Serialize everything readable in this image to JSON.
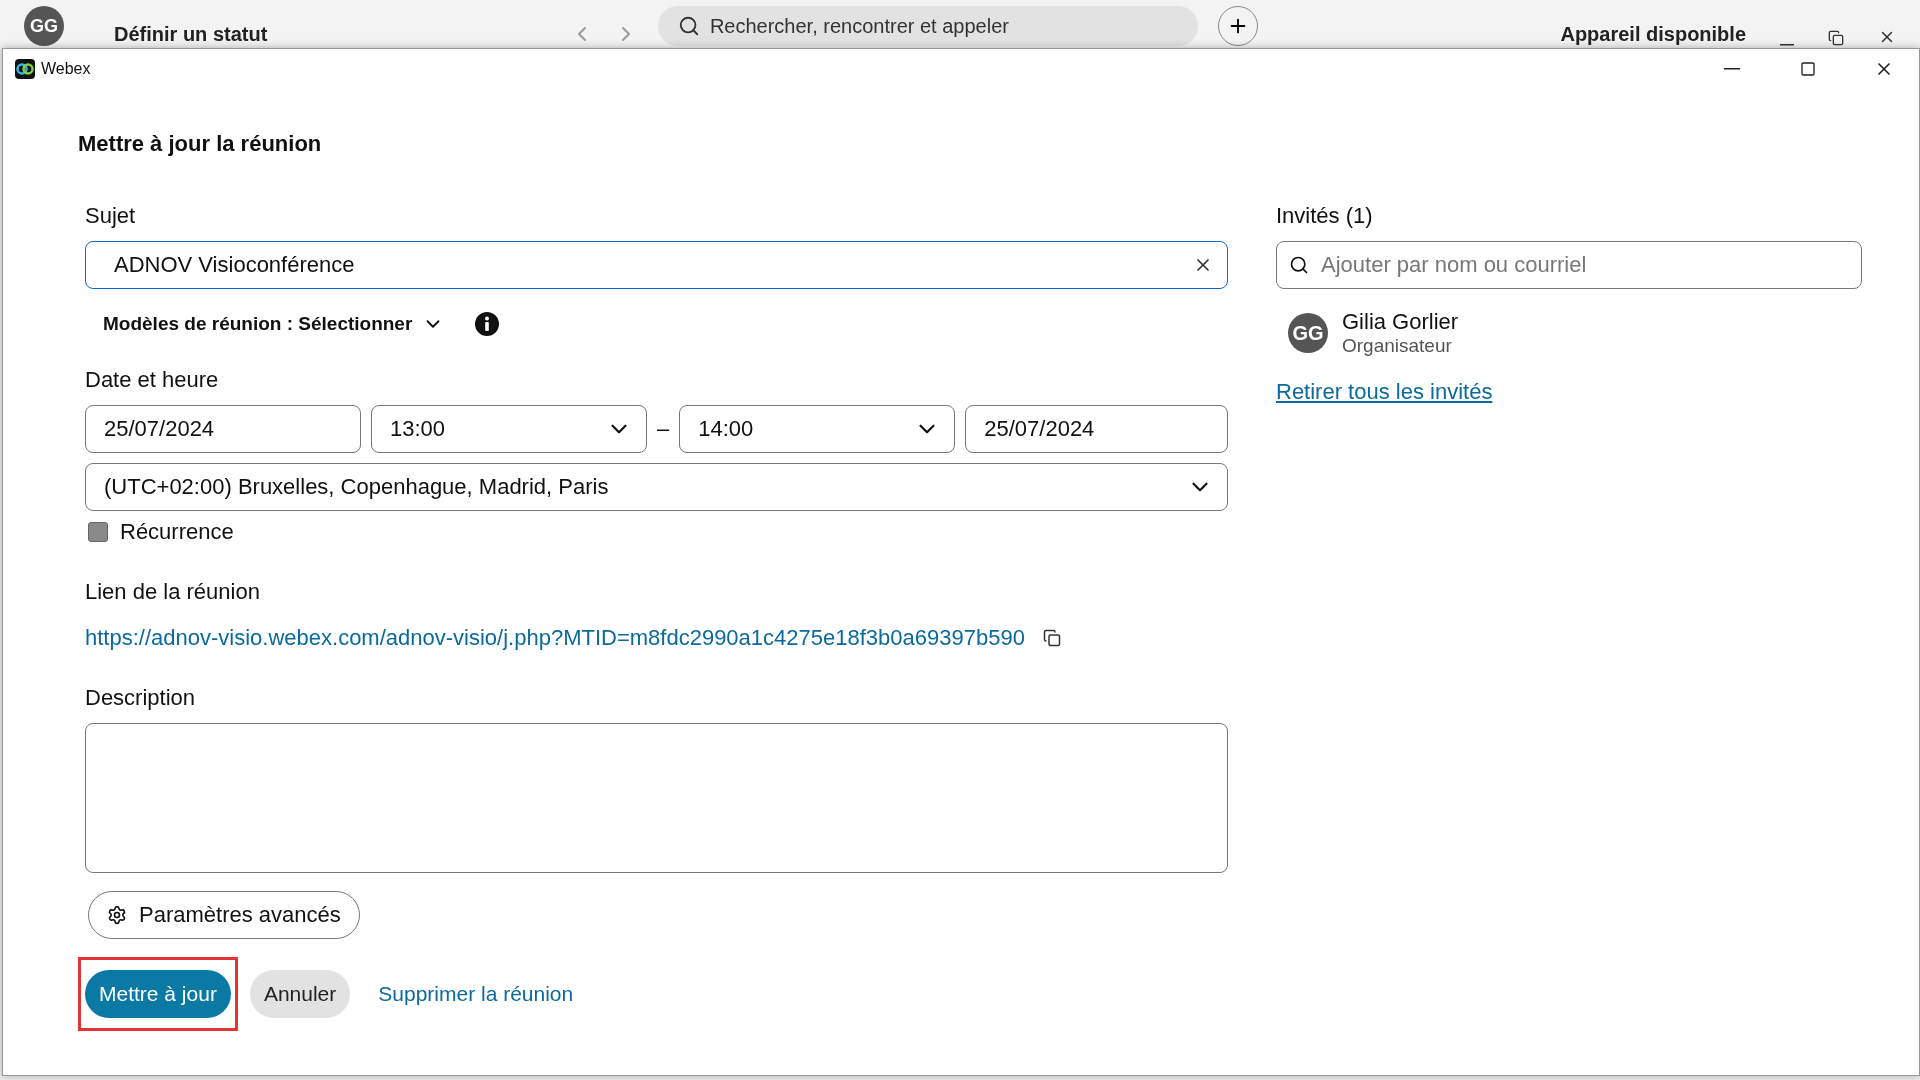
{
  "background_app": {
    "avatar_initials": "GG",
    "status": "Définir un statut",
    "search_placeholder": "Rechercher, rencontrer et appeler",
    "device": "Appareil disponible"
  },
  "window": {
    "title": "Webex",
    "heading": "Mettre à jour la réunion"
  },
  "subject": {
    "label": "Sujet",
    "value": "ADNOV Visioconférence",
    "focused": true
  },
  "templates": {
    "label": "Modèles de réunion : Sélectionner"
  },
  "datetime": {
    "label": "Date et heure",
    "start_date": "25/07/2024",
    "start_time": "13:00",
    "separator": "–",
    "end_time": "14:00",
    "end_date": "25/07/2024",
    "timezone": "(UTC+02:00) Bruxelles, Copenhague, Madrid, Paris"
  },
  "recurrence": {
    "label": "Récurrence",
    "checked": false
  },
  "link": {
    "label": "Lien de la réunion",
    "url": "https://adnov-visio.webex.com/adnov-visio/j.php?MTID=m8fdc2990a1c4275e18f3b0a69397b590"
  },
  "description": {
    "label": "Description"
  },
  "advanced_button": "Paramètres avancés",
  "actions": [
    {
      "label": "Mettre à jour",
      "kind": "primary",
      "highlighted": true
    },
    {
      "label": "Annuler",
      "kind": "secondary",
      "highlighted": false
    },
    {
      "label": "Supprimer la réunion",
      "kind": "link",
      "highlighted": false
    }
  ],
  "invitees": {
    "label": "Invités (1)",
    "search_placeholder": "Ajouter par nom ou courriel",
    "people": [
      {
        "initials": "GG",
        "name": "Gilia Gorlier",
        "role": "Organisateur"
      }
    ],
    "remove_all": "Retirer tous les invités"
  }
}
